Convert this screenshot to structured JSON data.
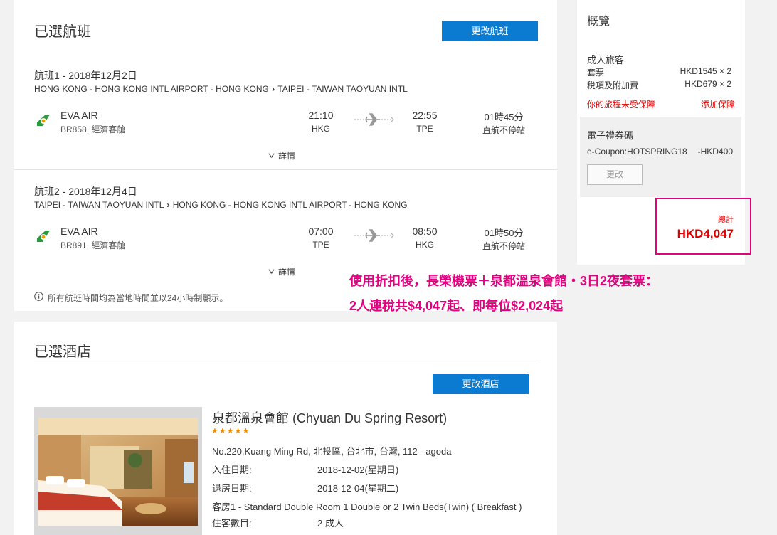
{
  "flights": {
    "title": "已選航班",
    "change_button": "更改航班",
    "items": [
      {
        "date": "航班1 - 2018年12月2日",
        "route_from": "HONG KONG - HONG KONG INTL AIRPORT - HONG KONG",
        "route_to": "TAIPEI - TAIWAN TAOYUAN INTL",
        "airline": "EVA AIR",
        "flight_no": "BR858, 經濟客艙",
        "dep_time": "21:10",
        "dep_code": "HKG",
        "arr_time": "22:55",
        "arr_code": "TPE",
        "duration": "01時45分",
        "stops": "直航不停站",
        "details": "詳情"
      },
      {
        "date": "航班2 - 2018年12月4日",
        "route_from": "TAIPEI - TAIWAN TAOYUAN INTL",
        "route_to": "HONG KONG - HONG KONG INTL AIRPORT - HONG KONG",
        "airline": "EVA AIR",
        "flight_no": "BR891, 經濟客艙",
        "dep_time": "07:00",
        "dep_code": "TPE",
        "arr_time": "08:50",
        "arr_code": "HKG",
        "duration": "01時50分",
        "stops": "直航不停站",
        "details": "詳情"
      }
    ],
    "note": "所有航班時間均為當地時間並以24小時制顯示。"
  },
  "promo": {
    "line1": "使用折扣後，長榮機票＋泉都溫泉會館・3日2夜套票：",
    "line2": "2人連稅共$4,047起、即每位$2,024起"
  },
  "hotel": {
    "title": "已選酒店",
    "change_button": "更改酒店",
    "name": "泉都溫泉會館 (Chyuan Du Spring Resort)",
    "stars": "★★★★★",
    "star_rating": 4.5,
    "address": "No.220,Kuang Ming Rd, 北投區, 台北市, 台灣, 112 - agoda",
    "checkin_label": "入住日期:",
    "checkin_value": "2018-12-02(星期日)",
    "checkout_label": "退房日期:",
    "checkout_value": "2018-12-04(星期二)",
    "room": "客房1 - Standard Double Room 1 Double or 2 Twin Beds(Twin) ( Breakfast )",
    "guests_label": "住客數目:",
    "guests_value": "2 成人"
  },
  "summary": {
    "title": "概覽",
    "adult_label": "成人旅客",
    "fare_label": "套票",
    "fare_value": "HKD1545 × 2",
    "tax_label": "稅項及附加費",
    "tax_value": "HKD679 × 2",
    "unprotected": "你的旅程未受保障",
    "add_protection": "添加保障",
    "coupon_title": "電子禮券碼",
    "coupon_code": "e-Coupon:HOTSPRING18",
    "coupon_value": "-HKD400",
    "coupon_change": "更改",
    "total_label": "總計",
    "total_value": "HKD4,047"
  },
  "colors": {
    "accent_blue": "#0a7bd1",
    "promo_pink": "#e4007f",
    "price_red": "#e00000",
    "star_orange": "#f08a00"
  }
}
